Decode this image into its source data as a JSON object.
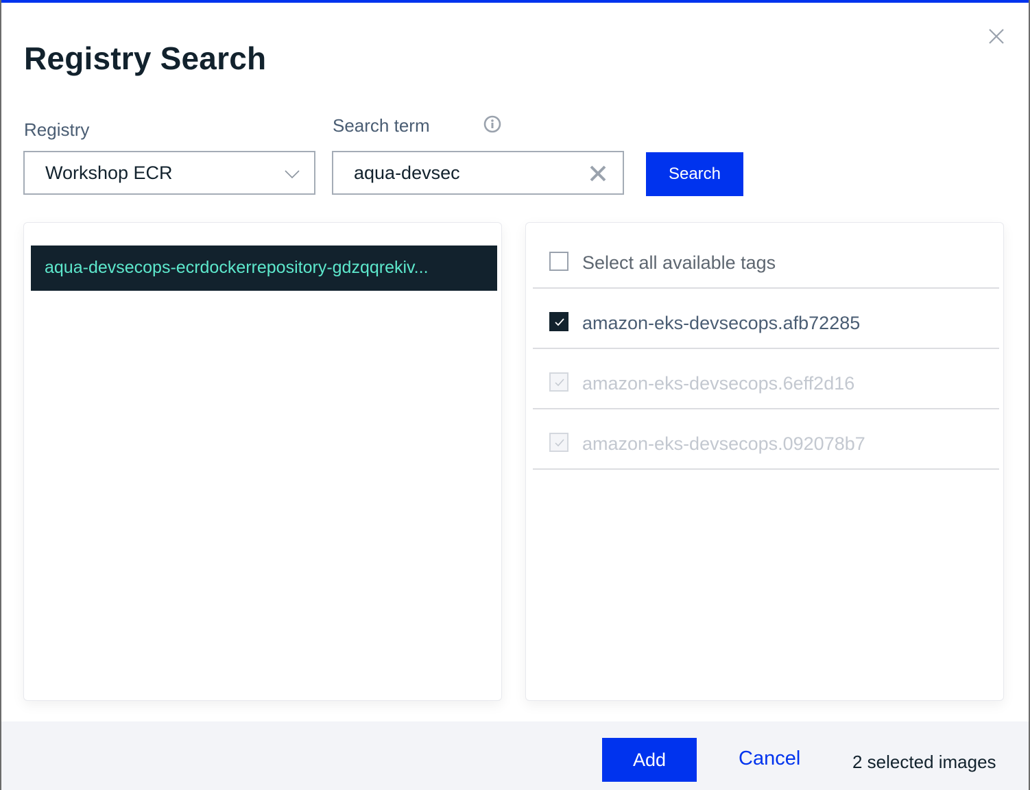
{
  "dialog": {
    "title": "Registry Search",
    "close_icon": "close-icon"
  },
  "form": {
    "registry_label": "Registry",
    "registry_value": "Workshop ECR",
    "search_label": "Search term",
    "search_value": "aqua-devsec",
    "search_placeholder": "",
    "search_button": "Search"
  },
  "repositories": [
    {
      "name": "aqua-devsecops-ecrdockerrepository-gdzqqrekiv...",
      "selected": true
    }
  ],
  "tags": {
    "select_all_label": "Select all available tags",
    "select_all_checked": false,
    "items": [
      {
        "name": "amazon-eks-devsecops.afb72285",
        "checked": true,
        "disabled": false
      },
      {
        "name": "amazon-eks-devsecops.6eff2d16",
        "checked": true,
        "disabled": true
      },
      {
        "name": "amazon-eks-devsecops.092078b7",
        "checked": true,
        "disabled": true
      }
    ]
  },
  "footer": {
    "add_label": "Add",
    "cancel_label": "Cancel",
    "selected_count": "2 selected images"
  },
  "colors": {
    "accent": "#0033ee",
    "selected_bg": "#12222d",
    "selected_text": "#5de8cc"
  }
}
